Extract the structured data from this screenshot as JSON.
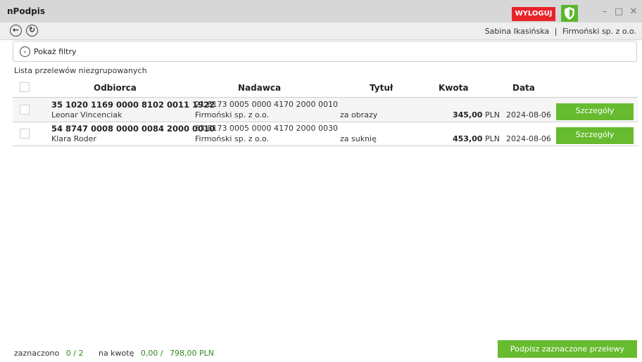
{
  "window": {
    "title": "nPodpis",
    "logout_label": "WYLOGUJ",
    "minimize": "–",
    "maximize": "□",
    "close": "✕"
  },
  "nav": {
    "back_icon": "←",
    "refresh_icon": "↻",
    "user": "Sabina Ikasińska",
    "separator": "|",
    "company": "Firmoński sp. z o.o."
  },
  "filters": {
    "toggle_icon": "⌄",
    "label": "Pokaż filtry"
  },
  "list": {
    "title": "Lista przelewów niezgrupowanych",
    "headers": {
      "recipient": "Odbiorca",
      "sender": "Nadawca",
      "title": "Tytuł",
      "amount": "Kwota",
      "date": "Data"
    },
    "rows": [
      {
        "recipient_account": "35 1020 1169 0000 8102 0011 1922",
        "recipient_name": "Leonar Vincenciak",
        "sender_account": "21 8173 0005 0000 4170 2000 0010",
        "sender_name": "Firmoński sp. z o.o.",
        "title": "za obrazy",
        "amount": "345,00",
        "currency": "PLN",
        "date": "2024-08-06",
        "details_label": "Szczegóły"
      },
      {
        "recipient_account": "54 8747 0008 0000 0084 2000 0010",
        "recipient_name": "Klara Roder",
        "sender_account": "63 8173 0005 0000 4170 2000 0030",
        "sender_name": "Firmoński sp. z o.o.",
        "title": "za suknię",
        "amount": "453,00",
        "currency": "PLN",
        "date": "2024-08-06",
        "details_label": "Szczegóły"
      }
    ]
  },
  "footer": {
    "selected_label": "zaznaczono",
    "selected_value": "0 / 2",
    "amount_label": "na kwotę",
    "amount_value": "0,00 /",
    "amount_total": "798,00 PLN",
    "sign_button": "Podpisz zaznaczone przelewy"
  },
  "colors": {
    "accent_green": "#66bb2e",
    "logout_red": "#e8232a",
    "shield_green": "#58b82c"
  }
}
